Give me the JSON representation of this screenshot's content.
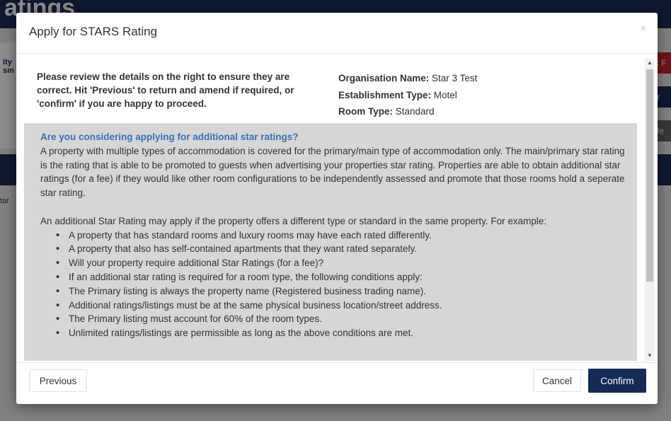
{
  "background": {
    "header_title": "atings",
    "logo_text": "ity\nsm",
    "side_text": "tar",
    "right_buttons": [
      "R F",
      "/ r",
      "ide"
    ]
  },
  "modal": {
    "title": "Apply for STARS Rating",
    "close_symbol": "×",
    "review_text": "Please review the details on the right to ensure they are correct. Hit 'Previous' to return and amend if required, or 'confirm' if you are happy to proceed.",
    "details": [
      {
        "label": "Organisation Name:",
        "value": "Star 3 Test"
      },
      {
        "label": "Establishment Type:",
        "value": "Motel"
      },
      {
        "label": "Room Type:",
        "value": "Standard"
      }
    ],
    "info": {
      "heading": "Are you considering applying for additional star ratings?",
      "paragraph1": "A property with multiple types of accommodation is covered for the primary/main type of accommodation only. The main/primary star rating is the rating that is able to be promoted to guests when advertising your properties star rating. Properties are able to obtain additional star ratings (for a fee) if they would like other room configurations to be independently assessed and promote that those rooms hold a seperate star rating.",
      "paragraph2": "An additional Star Rating may apply if the property offers a different type or standard in the same property. For example:",
      "bullets": [
        "A property that has standard rooms and luxury rooms may have each rated differently.",
        "A property that also has self-contained apartments that they want rated separately.",
        "Will your property require additional Star Ratings (for a fee)?",
        "If an additional star rating is required for a room type, the following conditions apply:",
        "The Primary listing is always the property name (Registered business trading name).",
        "Additional ratings/listings must be at the same physical business location/street address.",
        "The Primary listing must account for 60% of the room types.",
        "Unlimited ratings/listings are permissible as long as the above conditions are met."
      ]
    },
    "buttons": {
      "previous": "Previous",
      "cancel": "Cancel",
      "confirm": "Confirm"
    }
  }
}
